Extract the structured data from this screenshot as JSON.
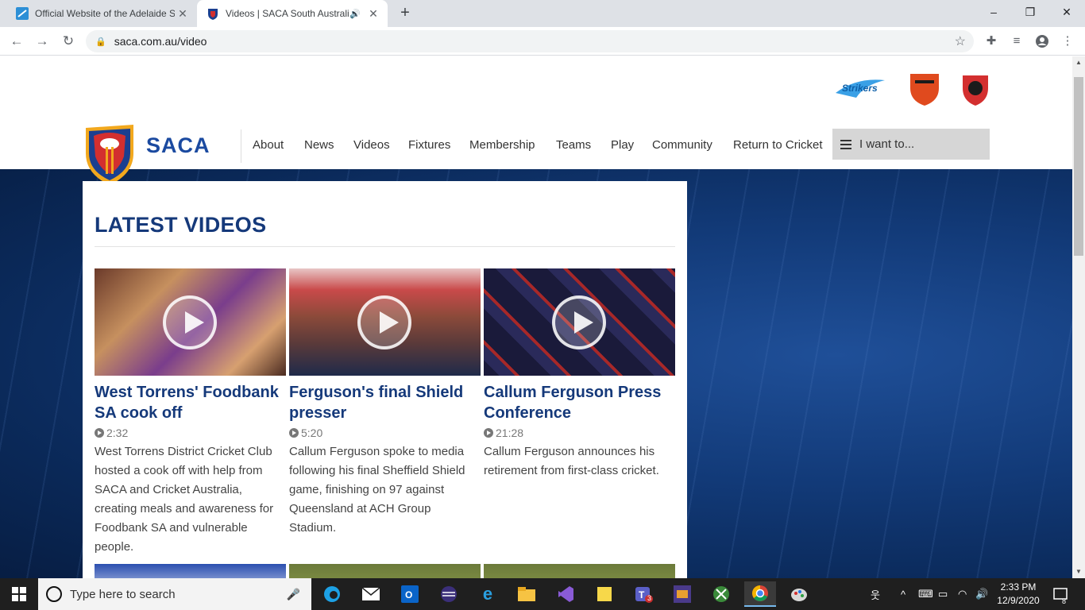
{
  "browser": {
    "tabs": [
      {
        "title": "Official Website of the Adelaide S",
        "active": false
      },
      {
        "title": "Videos | SACA South Australi",
        "active": true
      }
    ],
    "url": "saca.com.au/video",
    "window_controls": {
      "minimize": "–",
      "restore": "❐",
      "close": "✕"
    }
  },
  "site": {
    "logo_text": "SACA",
    "team_logos": [
      "Adelaide Strikers",
      "Scorpions",
      "Redbacks"
    ],
    "nav": [
      "About",
      "News",
      "Videos",
      "Fixtures",
      "Membership",
      "Teams",
      "Play",
      "Community",
      "Return to Cricket"
    ],
    "i_want_label": "I want to...",
    "section_title": "LATEST VIDEOS",
    "videos": [
      {
        "title": "West Torrens' Foodbank SA cook off",
        "duration": "2:32",
        "description": "West Torrens District Cricket Club hosted a cook off with help from SACA and Cricket Australia, creating meals and awareness for Foodbank SA and vulnerable people."
      },
      {
        "title": "Ferguson's final Shield presser",
        "duration": "5:20",
        "description": "Callum Ferguson spoke to media following his final Sheffield Shield game, finishing on 97 against Queensland at ACH Group Stadium."
      },
      {
        "title": "Callum Ferguson Press Conference",
        "duration": "21:28",
        "description": "Callum Ferguson announces his retirement from first-class cricket."
      }
    ]
  },
  "taskbar": {
    "search_placeholder": "Type here to search",
    "time": "2:33 PM",
    "date": "12/9/2020",
    "notification_count": "8",
    "teams_badge": "3"
  },
  "colors": {
    "brand_blue": "#15397a",
    "bg_blue": "#123a78",
    "header_bg": "#ffffff"
  }
}
